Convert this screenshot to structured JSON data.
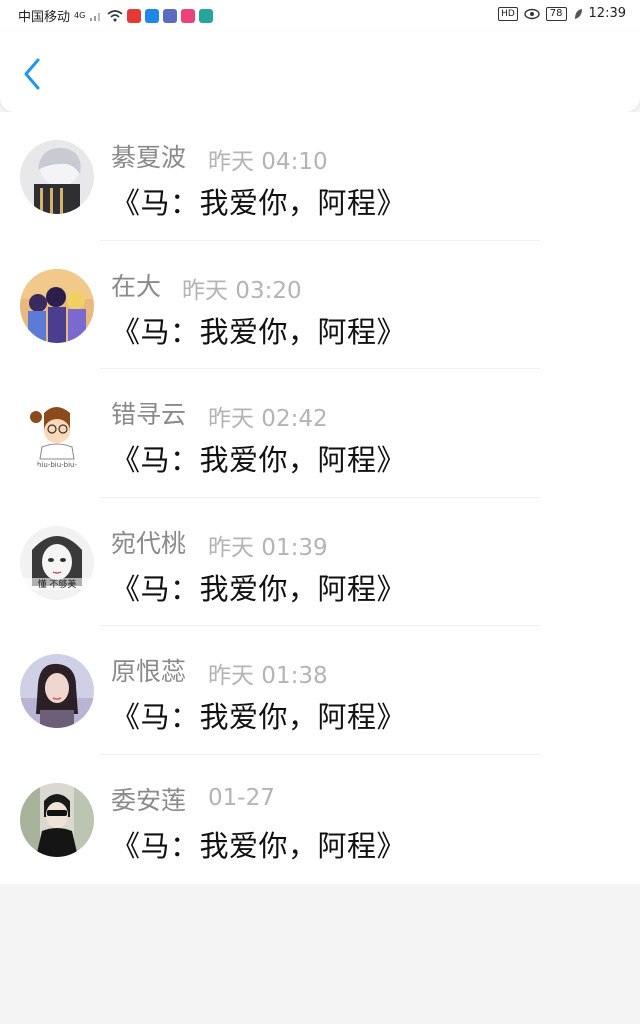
{
  "status_bar": {
    "carrier": "中国移动",
    "network": "4G",
    "hd": "HD",
    "battery": "78",
    "time": "12:39"
  },
  "header": {
    "back_icon": "chevron-left-icon",
    "accent_color": "#2196f3"
  },
  "messages": [
    {
      "name": "綦夏波",
      "time": "昨天 04:10",
      "text": "《马：我爱你，阿程》"
    },
    {
      "name": "在大",
      "time": "昨天 03:20",
      "text": "《马：我爱你，阿程》"
    },
    {
      "name": "错寻云",
      "time": "昨天 02:42",
      "text": "《马：我爱你，阿程》"
    },
    {
      "name": "宛代桃",
      "time": "昨天 01:39",
      "text": "《马：我爱你，阿程》"
    },
    {
      "name": "原恨蕊",
      "time": "昨天 01:38",
      "text": "《马：我爱你，阿程》"
    },
    {
      "name": "委安莲",
      "time": "01-27",
      "text": "《马：我爱你，阿程》"
    }
  ]
}
